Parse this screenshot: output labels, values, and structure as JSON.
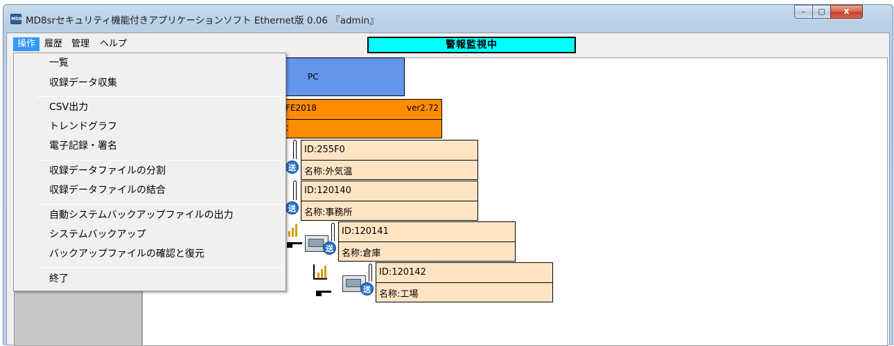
{
  "window": {
    "title": "MD8srセキュリティ機能付きアプリケーションソフト Ethernet版 0.06 『admin』",
    "icon_label": "MD8",
    "buttons": {
      "minimize": "–",
      "maximize": "□",
      "close": "x"
    }
  },
  "menubar": {
    "items": [
      "操作",
      "履歴",
      "管理",
      "ヘルプ"
    ],
    "active_index": 0,
    "status_banner": "警報監視中"
  },
  "dropdown": {
    "items": [
      "一覧",
      "収録データ収集",
      "CSV出力",
      "トレンドグラフ",
      "電子記録・署名",
      "収録データファイルの分割",
      "収録データファイルの結合",
      "自動システムバックアップファイルの出力",
      "システムバックアップ",
      "バックアップファイルの確認と復元",
      "終了"
    ]
  },
  "tree": {
    "pc": {
      "label": "PC"
    },
    "base": {
      "model_fragment": "FE2018",
      "version": "ver2.72",
      "name_fragment": "："
    },
    "devices": [
      {
        "id_text": "ID:255F0",
        "name_text": "名称:外気温"
      },
      {
        "id_text": "ID:120140",
        "name_text": "名称:事務所"
      },
      {
        "id_text": "ID:120141",
        "name_text": "名称:倉庫"
      },
      {
        "id_text": "ID:120142",
        "name_text": "名称:工場"
      }
    ],
    "send_icon_text": "送"
  },
  "colors": {
    "menu_highlight": "#3399ff",
    "banner": "#00ffff",
    "pc_node": "#6495ed",
    "base_node": "#ff8c00",
    "device_node": "#ffe4c4"
  }
}
